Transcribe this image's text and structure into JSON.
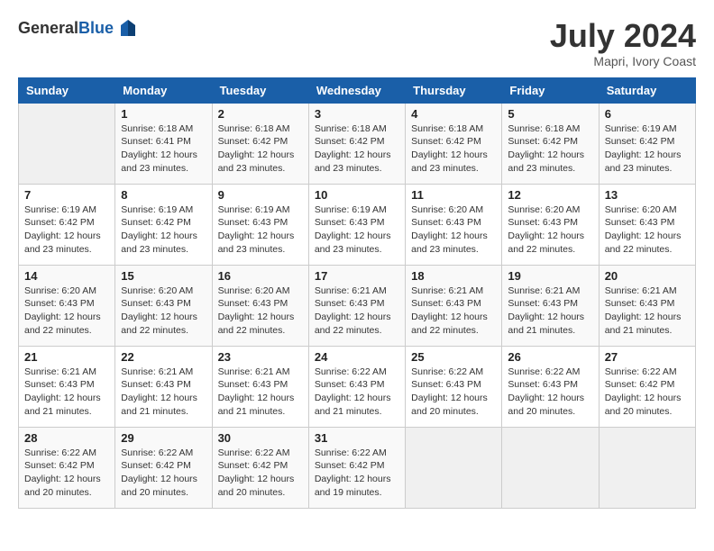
{
  "header": {
    "logo_general": "General",
    "logo_blue": "Blue",
    "month_year": "July 2024",
    "location": "Mapri, Ivory Coast"
  },
  "columns": [
    "Sunday",
    "Monday",
    "Tuesday",
    "Wednesday",
    "Thursday",
    "Friday",
    "Saturday"
  ],
  "weeks": [
    [
      {
        "day": "",
        "detail": ""
      },
      {
        "day": "1",
        "detail": "Sunrise: 6:18 AM\nSunset: 6:41 PM\nDaylight: 12 hours\nand 23 minutes."
      },
      {
        "day": "2",
        "detail": "Sunrise: 6:18 AM\nSunset: 6:42 PM\nDaylight: 12 hours\nand 23 minutes."
      },
      {
        "day": "3",
        "detail": "Sunrise: 6:18 AM\nSunset: 6:42 PM\nDaylight: 12 hours\nand 23 minutes."
      },
      {
        "day": "4",
        "detail": "Sunrise: 6:18 AM\nSunset: 6:42 PM\nDaylight: 12 hours\nand 23 minutes."
      },
      {
        "day": "5",
        "detail": "Sunrise: 6:18 AM\nSunset: 6:42 PM\nDaylight: 12 hours\nand 23 minutes."
      },
      {
        "day": "6",
        "detail": "Sunrise: 6:19 AM\nSunset: 6:42 PM\nDaylight: 12 hours\nand 23 minutes."
      }
    ],
    [
      {
        "day": "7",
        "detail": "Sunrise: 6:19 AM\nSunset: 6:42 PM\nDaylight: 12 hours\nand 23 minutes."
      },
      {
        "day": "8",
        "detail": "Sunrise: 6:19 AM\nSunset: 6:42 PM\nDaylight: 12 hours\nand 23 minutes."
      },
      {
        "day": "9",
        "detail": "Sunrise: 6:19 AM\nSunset: 6:43 PM\nDaylight: 12 hours\nand 23 minutes."
      },
      {
        "day": "10",
        "detail": "Sunrise: 6:19 AM\nSunset: 6:43 PM\nDaylight: 12 hours\nand 23 minutes."
      },
      {
        "day": "11",
        "detail": "Sunrise: 6:20 AM\nSunset: 6:43 PM\nDaylight: 12 hours\nand 23 minutes."
      },
      {
        "day": "12",
        "detail": "Sunrise: 6:20 AM\nSunset: 6:43 PM\nDaylight: 12 hours\nand 22 minutes."
      },
      {
        "day": "13",
        "detail": "Sunrise: 6:20 AM\nSunset: 6:43 PM\nDaylight: 12 hours\nand 22 minutes."
      }
    ],
    [
      {
        "day": "14",
        "detail": "Sunrise: 6:20 AM\nSunset: 6:43 PM\nDaylight: 12 hours\nand 22 minutes."
      },
      {
        "day": "15",
        "detail": "Sunrise: 6:20 AM\nSunset: 6:43 PM\nDaylight: 12 hours\nand 22 minutes."
      },
      {
        "day": "16",
        "detail": "Sunrise: 6:20 AM\nSunset: 6:43 PM\nDaylight: 12 hours\nand 22 minutes."
      },
      {
        "day": "17",
        "detail": "Sunrise: 6:21 AM\nSunset: 6:43 PM\nDaylight: 12 hours\nand 22 minutes."
      },
      {
        "day": "18",
        "detail": "Sunrise: 6:21 AM\nSunset: 6:43 PM\nDaylight: 12 hours\nand 22 minutes."
      },
      {
        "day": "19",
        "detail": "Sunrise: 6:21 AM\nSunset: 6:43 PM\nDaylight: 12 hours\nand 21 minutes."
      },
      {
        "day": "20",
        "detail": "Sunrise: 6:21 AM\nSunset: 6:43 PM\nDaylight: 12 hours\nand 21 minutes."
      }
    ],
    [
      {
        "day": "21",
        "detail": "Sunrise: 6:21 AM\nSunset: 6:43 PM\nDaylight: 12 hours\nand 21 minutes."
      },
      {
        "day": "22",
        "detail": "Sunrise: 6:21 AM\nSunset: 6:43 PM\nDaylight: 12 hours\nand 21 minutes."
      },
      {
        "day": "23",
        "detail": "Sunrise: 6:21 AM\nSunset: 6:43 PM\nDaylight: 12 hours\nand 21 minutes."
      },
      {
        "day": "24",
        "detail": "Sunrise: 6:22 AM\nSunset: 6:43 PM\nDaylight: 12 hours\nand 21 minutes."
      },
      {
        "day": "25",
        "detail": "Sunrise: 6:22 AM\nSunset: 6:43 PM\nDaylight: 12 hours\nand 20 minutes."
      },
      {
        "day": "26",
        "detail": "Sunrise: 6:22 AM\nSunset: 6:43 PM\nDaylight: 12 hours\nand 20 minutes."
      },
      {
        "day": "27",
        "detail": "Sunrise: 6:22 AM\nSunset: 6:42 PM\nDaylight: 12 hours\nand 20 minutes."
      }
    ],
    [
      {
        "day": "28",
        "detail": "Sunrise: 6:22 AM\nSunset: 6:42 PM\nDaylight: 12 hours\nand 20 minutes."
      },
      {
        "day": "29",
        "detail": "Sunrise: 6:22 AM\nSunset: 6:42 PM\nDaylight: 12 hours\nand 20 minutes."
      },
      {
        "day": "30",
        "detail": "Sunrise: 6:22 AM\nSunset: 6:42 PM\nDaylight: 12 hours\nand 20 minutes."
      },
      {
        "day": "31",
        "detail": "Sunrise: 6:22 AM\nSunset: 6:42 PM\nDaylight: 12 hours\nand 19 minutes."
      },
      {
        "day": "",
        "detail": ""
      },
      {
        "day": "",
        "detail": ""
      },
      {
        "day": "",
        "detail": ""
      }
    ]
  ]
}
